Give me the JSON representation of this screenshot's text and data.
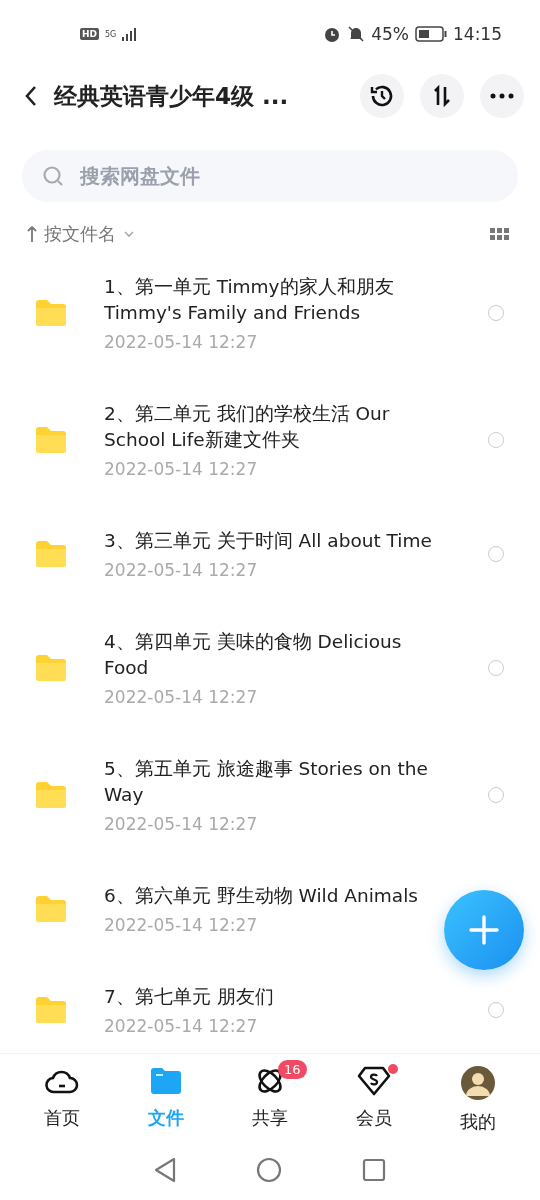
{
  "status_bar": {
    "network_badge": "HD",
    "network_type": "5G",
    "battery": "45%",
    "time": "14:15"
  },
  "header": {
    "title": "经典英语青少年4级 ..."
  },
  "search": {
    "placeholder": "搜索网盘文件"
  },
  "sort": {
    "label": "按文件名"
  },
  "files": [
    {
      "name": "1、第一单元 Timmy的家人和朋友 Timmy's Family and Friends",
      "date": "2022-05-14  12:27",
      "selected": false
    },
    {
      "name": "2、第二单元 我们的学校生活 Our School Life新建文件夹",
      "date": "2022-05-14  12:27",
      "selected": false
    },
    {
      "name": "3、第三单元 关于时间 All about Time",
      "date": "2022-05-14  12:27",
      "selected": false
    },
    {
      "name": "4、第四单元 美味的食物 Delicious Food",
      "date": "2022-05-14  12:27",
      "selected": false
    },
    {
      "name": "5、第五单元 旅途趣事 Stories on the Way",
      "date": "2022-05-14  12:27",
      "selected": false
    },
    {
      "name": "6、第六单元 野生动物 Wild Animals",
      "date": "2022-05-14  12:27"
    },
    {
      "name": "7、第七单元 朋友们",
      "date": "2022-05-14  12:27",
      "selected": false
    }
  ],
  "tabs": [
    {
      "kind": "home",
      "label": "首页",
      "selected": false
    },
    {
      "kind": "files",
      "label": "文件",
      "selected": true
    },
    {
      "kind": "share",
      "label": "共享",
      "selected": false,
      "badge": "16"
    },
    {
      "kind": "vip",
      "label": "会员",
      "selected": false,
      "dot": true
    },
    {
      "kind": "me",
      "label": "我的",
      "selected": false
    }
  ]
}
